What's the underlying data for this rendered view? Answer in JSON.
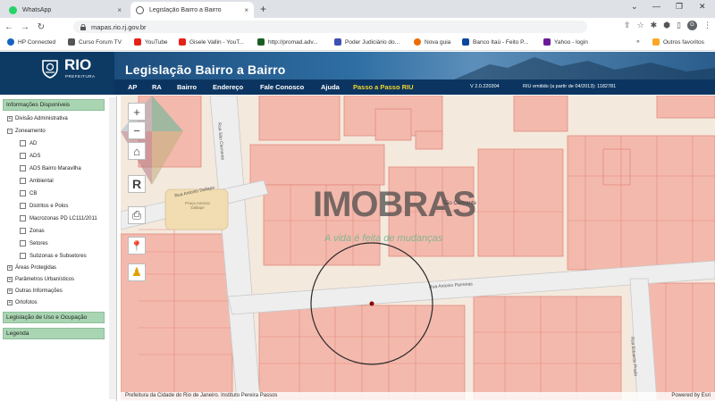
{
  "browser": {
    "tabs": [
      {
        "title": "WhatsApp",
        "close": "×"
      },
      {
        "title": "Legislação Bairro a Bairro",
        "close": "×"
      }
    ],
    "new_tab": "+",
    "window_controls": [
      "⌄",
      "—",
      "❐",
      "✕"
    ],
    "nav": {
      "back": "←",
      "forward": "→",
      "reload": "↻"
    },
    "url": "mapas.rio.rj.gov.br",
    "bookmarks": [
      {
        "label": "HP Connected",
        "color": "#1565c0"
      },
      {
        "label": "Curso Forum TV",
        "color": "#555555"
      },
      {
        "label": "YouTube",
        "color": "#e62117"
      },
      {
        "label": "Gisele Vallin - YouT...",
        "color": "#e62117"
      },
      {
        "label": "http://promad.adv...",
        "color": "#1b5e20"
      },
      {
        "label": "Poder Judiciário do...",
        "color": "#3f51b5"
      },
      {
        "label": "Nova guia",
        "color": "#ef6c00"
      },
      {
        "label": "Banco Itaú - Feito P...",
        "color": "#0d47a1"
      },
      {
        "label": "Yahoo - login",
        "color": "#6a1b9a"
      },
      {
        "label": "»",
        "color": "#ffffff"
      },
      {
        "label": "Outros favoritos",
        "color": "#f9a825"
      }
    ]
  },
  "site": {
    "logo": "RIO",
    "logo_sub": "PREFEITURA",
    "title": "Legislação Bairro a Bairro",
    "menu": [
      "AP",
      "RA",
      "Bairro",
      "Endereço",
      "Fale Conosco",
      "Ajuda",
      "Passo a Passo RIU"
    ],
    "version": "V 2.0.220304",
    "riu_info": "RIU emitido (a partir de 04/2013): 1182781"
  },
  "sidebar": {
    "panel_title": "Informações Disponíveis",
    "items": [
      {
        "label": "Divisão Administrativa",
        "level": 0,
        "toggle": "+"
      },
      {
        "label": "Zoneamento",
        "level": 0,
        "toggle": "−"
      },
      {
        "label": "AD",
        "level": 1
      },
      {
        "label": "ADS",
        "level": 1
      },
      {
        "label": "ADS Bairro Maravilha",
        "level": 1
      },
      {
        "label": "Ambiental",
        "level": 1
      },
      {
        "label": "CB",
        "level": 1
      },
      {
        "label": "Distritos e Polos",
        "level": 1
      },
      {
        "label": "Macrozonas PD LC111/2011",
        "level": 1
      },
      {
        "label": "Zonas",
        "level": 1
      },
      {
        "label": "Setores",
        "level": 1
      },
      {
        "label": "Subzonas e Subsetores",
        "level": 1
      },
      {
        "label": "Áreas Protegidas",
        "level": 0,
        "toggle": "+"
      },
      {
        "label": "Parâmetros Urbanísticos",
        "level": 0,
        "toggle": "+"
      },
      {
        "label": "Outras Informações",
        "level": 0,
        "toggle": "+"
      },
      {
        "label": "Ortofotos",
        "level": 0,
        "toggle": "+"
      }
    ],
    "panel2": "Legislação de Uso e Ocupação",
    "panel3": "Legenda"
  },
  "map": {
    "controls": {
      "zoom_in": "+",
      "zoom_out": "−",
      "home": "⌂",
      "r_button": "R",
      "print": "⎙",
      "maps": "📍",
      "person": "♟"
    },
    "street_labels": [
      "Rua São Clemente",
      "Rua Antonio Dallape",
      "Praça Antonio Dallape",
      "Rua Antonio Parreiras",
      "Rua Eduardo Prado",
      "São Clemente"
    ],
    "watermark": {
      "brand": "IMOBRAS",
      "tagline": "A vida é feita de mudanças"
    },
    "attribution_left": "Prefeitura da Cidade do Rio de Janeiro. Instituto Pereira Passos",
    "attribution_right": "Powered by Esri"
  }
}
